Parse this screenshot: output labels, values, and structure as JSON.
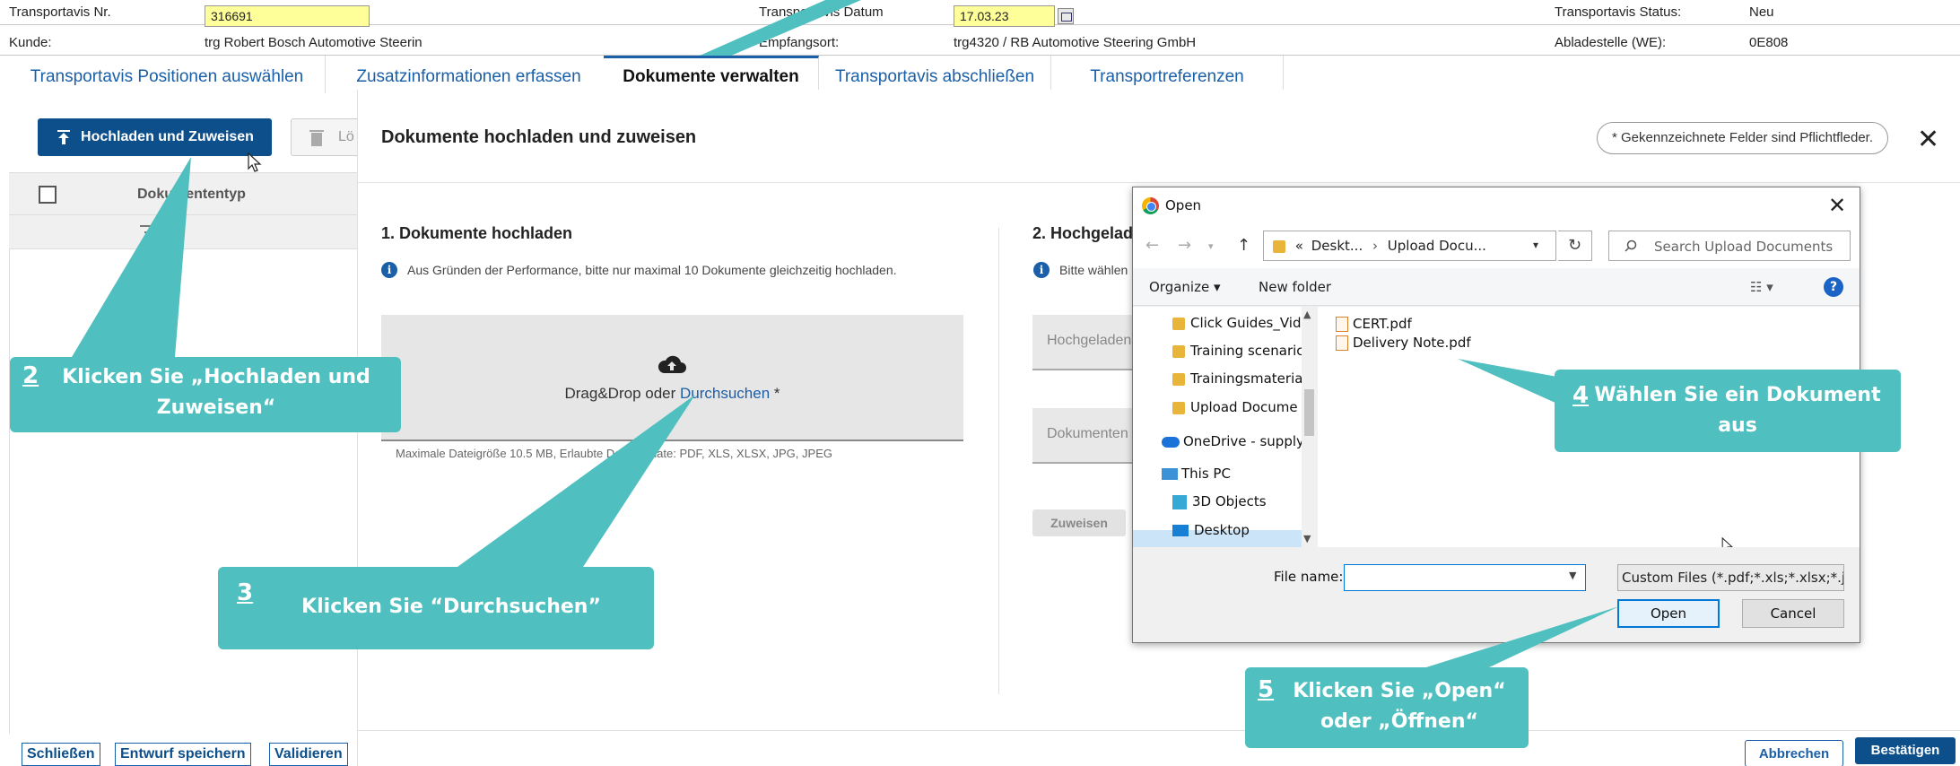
{
  "header": {
    "transportavis_nr_label": "Transportavis Nr.",
    "transportavis_nr_value": "316691",
    "transportavis_datum_label": "Transportavis Datum",
    "transportavis_datum_value": "17.03.23",
    "transportavis_status_label": "Transportavis Status:",
    "transportavis_status_value": "Neu",
    "kunde_label": "Kunde:",
    "kunde_value": "trg Robert Bosch Automotive Steerin",
    "empfangsort_label": "Empfangsort:",
    "empfangsort_value": "trg4320 / RB Automotive Steering GmbH",
    "abladestelle_label": "Abladestelle (WE):",
    "abladestelle_value": "0E808"
  },
  "tabs": [
    {
      "label": "Transportavis Positionen auswählen"
    },
    {
      "label": "Zusatzinformationen erfassen"
    },
    {
      "label": "Dokumente verwalten"
    },
    {
      "label": "Transportavis abschließen"
    },
    {
      "label": "Transportreferenzen"
    }
  ],
  "left_panel": {
    "upload_assign_label": "Hochladen und Zuweisen",
    "delete_label": "Lö",
    "column_doc_type": "Dokumententyp"
  },
  "modal": {
    "title": "Dokumente hochladen und zuweisen",
    "required_note": "* Gekennzeichnete Felder sind Pflichtfleder.",
    "section1_title": "1. Dokumente hochladen",
    "section1_info": "Aus Gründen der Performance, bitte nur maximal 10 Dokumente gleichzeitig hochladen.",
    "dropzone_text": "Drag&Drop oder ",
    "dropzone_link": "Durchsuchen",
    "dropzone_required": " *",
    "dropzone_hint": "Maximale Dateigröße 10.5 MB, Erlaubte Dateiformate: PDF, XLS, XLSX, JPG, JPEG",
    "section2_title": "2. Hochgelad",
    "section2_info": "Bitte wählen",
    "field_uploaded": "Hochgeladen",
    "field_doctype": "Dokumenten",
    "assign_label": "Zuweisen",
    "cancel_label": "Abbrechen",
    "confirm_label": "Bestätigen"
  },
  "bottom_buttons": {
    "close": "Schließen",
    "save_draft": "Entwurf speichern",
    "validate": "Validieren"
  },
  "open_dialog": {
    "title": "Open",
    "address_prefix": "«",
    "address_part1": "Deskt...",
    "address_part2": "Upload Docu...",
    "search_placeholder": "Search Upload Documents",
    "organize": "Organize",
    "new_folder": "New folder",
    "help": "?",
    "tree": [
      "Click Guides_Vid",
      "Training scenaric",
      "Trainingsmateria",
      "Upload Docume",
      "OneDrive - supply",
      "This PC",
      "3D Objects",
      "Desktop"
    ],
    "files": [
      "CERT.pdf",
      "Delivery Note.pdf"
    ],
    "file_name_label": "File name:",
    "file_name_value": "",
    "filter_value": "Custom Files (*.pdf;*.xls;*.xlsx;*.jpg",
    "open_label": "Open",
    "cancel_label": "Cancel"
  },
  "callouts": [
    {
      "number": "2",
      "text": "Klicken Sie  „Hochladen und Zuweisen“"
    },
    {
      "number": "3",
      "text": "Klicken Sie “Durchsuchen”"
    },
    {
      "number": "4",
      "text": "Wählen Sie ein Dokument aus"
    },
    {
      "number": "5",
      "text": "Klicken Sie „Open“ oder „Öffnen“"
    }
  ],
  "colors": {
    "callout": "#4fbfbf",
    "primary": "#0d4f8b",
    "link": "#1a5fa8",
    "highlight_field": "#ffff99"
  }
}
